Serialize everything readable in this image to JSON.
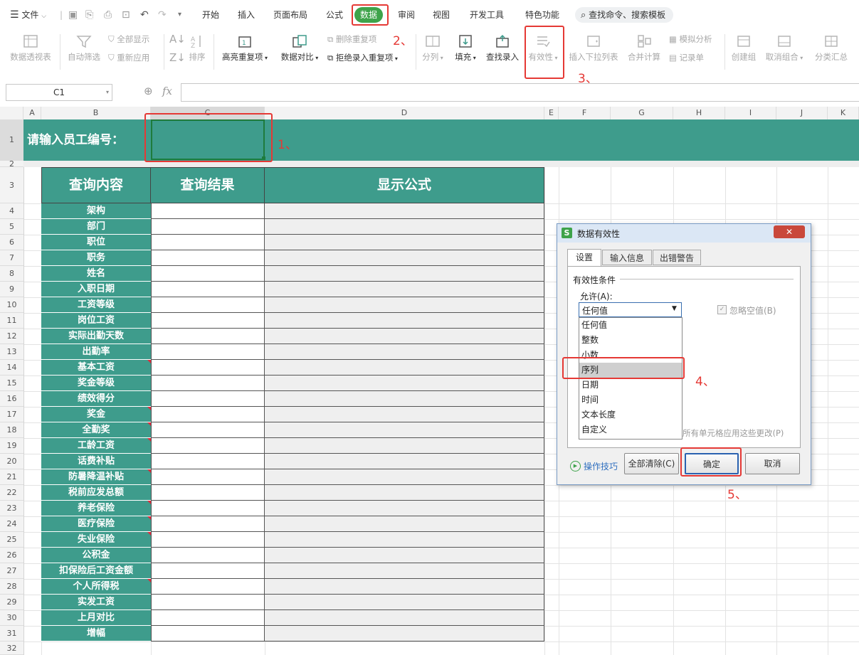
{
  "menu": {
    "file_label": "文件",
    "tabs": [
      "开始",
      "插入",
      "页面布局",
      "公式",
      "数据",
      "审阅",
      "视图",
      "开发工具",
      "特色功能"
    ],
    "search_placeholder": "查找命令、搜索模板"
  },
  "ribbon": {
    "pivot": "数据透视表",
    "autofilter": "自动筛选",
    "show_all": "全部显示",
    "reapply": "重新应用",
    "sort": "排序",
    "highlight_dup": "高亮重复项",
    "data_compare": "数据对比",
    "delete_dup": "删除重复项",
    "reject_dup": "拒绝录入重复项",
    "split": "分列",
    "fill": "填充",
    "lookup_entry": "查找录入",
    "validity": "有效性",
    "insert_dropdown": "插入下拉列表",
    "consolidate": "合并计算",
    "what_if": "模拟分析",
    "record_form": "记录单",
    "create_group": "创建组",
    "ungroup": "取消组合",
    "subtotal": "分类汇总"
  },
  "formula_bar": {
    "name_box": "C1",
    "fx": "fx",
    "zoom_icon": "magnifier-icon"
  },
  "sheet": {
    "columns": [
      "A",
      "B",
      "C",
      "D",
      "E",
      "F",
      "G",
      "H",
      "I",
      "J",
      "K"
    ],
    "rows": [
      "1",
      "2",
      "3",
      "4",
      "5",
      "6",
      "7",
      "8",
      "9",
      "10",
      "11",
      "12",
      "13",
      "14",
      "15",
      "16",
      "17",
      "18",
      "19",
      "20",
      "21",
      "22",
      "23",
      "24",
      "25",
      "26",
      "27",
      "28",
      "29",
      "30",
      "31",
      "32"
    ],
    "header_prompt": "请输入员工编号：",
    "table_headers": [
      "查询内容",
      "查询结果",
      "显示公式"
    ],
    "query_items": [
      "架构",
      "部门",
      "职位",
      "职务",
      "姓名",
      "入职日期",
      "工资等级",
      "岗位工资",
      "实际出勤天数",
      "出勤率",
      "基本工资",
      "奖金等级",
      "绩效得分",
      "奖金",
      "全勤奖",
      "工龄工资",
      "话费补贴",
      "防暑降温补贴",
      "税前应发总额",
      "养老保险",
      "医疗保险",
      "失业保险",
      "公积金",
      "扣保险后工资金额",
      "个人所得税",
      "实发工资",
      "上月对比",
      "增幅"
    ],
    "accent_color": "#3e9c8c"
  },
  "dialog": {
    "title": "数据有效性",
    "tabs": [
      "设置",
      "输入信息",
      "出错警告"
    ],
    "group_label": "有效性条件",
    "allow_label": "允许(A):",
    "allow_value": "任何值",
    "ignore_blank": "忽略空值(B)",
    "options": [
      "任何值",
      "整数",
      "小数",
      "序列",
      "日期",
      "时间",
      "文本长度",
      "自定义"
    ],
    "selected_option": "序列",
    "apply_all_partial": "所有单元格应用这些更改(P)",
    "tips": "操作技巧",
    "clear_all": "全部清除(C)",
    "ok": "确定",
    "cancel": "取消"
  },
  "annotations": [
    "1、",
    "2、",
    "3、",
    "4、",
    "5、"
  ]
}
